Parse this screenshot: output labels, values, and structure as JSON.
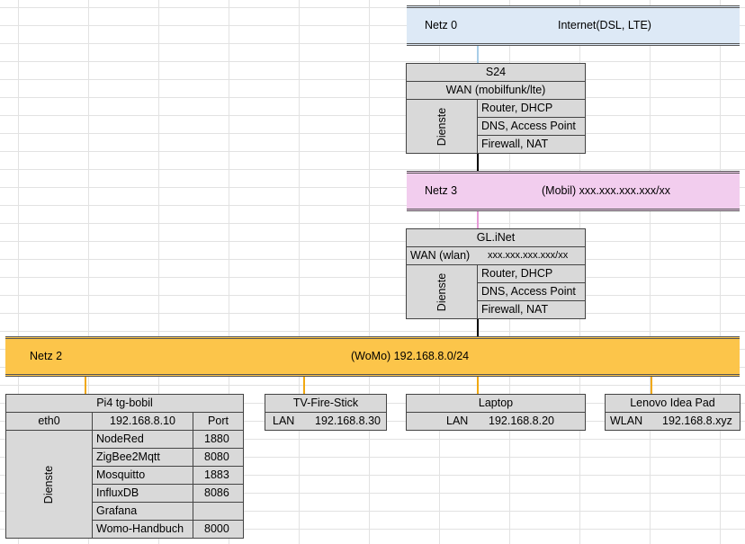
{
  "networks": {
    "netz0": {
      "label": "Netz 0",
      "description": "Internet(DSL, LTE)",
      "color": "#dde9f6"
    },
    "netz3": {
      "label": "Netz 3",
      "description": "(Mobil) xxx.xxx.xxx.xxx/xx",
      "color": "#f2cdee"
    },
    "netz2": {
      "label": "Netz 2",
      "description": "(WoMo) 192.168.8.0/24",
      "color": "#fcc54a"
    }
  },
  "s24": {
    "title": "S24",
    "wan": "WAN (mobilfunk/lte)",
    "dienste_label": "Dienste",
    "services": [
      "Router, DHCP",
      "DNS, Access Point",
      "Firewall, NAT"
    ]
  },
  "glinet": {
    "title": "GL.iNet",
    "wan_label": "WAN (wlan)",
    "wan_value": "xxx.xxx.xxx.xxx/xx",
    "dienste_label": "Dienste",
    "services": [
      "Router, DHCP",
      "DNS, Access Point",
      "Firewall, NAT"
    ]
  },
  "pi4": {
    "title": "Pi4 tg-bobil",
    "iface": "eth0",
    "ip": "192.168.8.10",
    "port_header": "Port",
    "dienste_label": "Dienste",
    "services": [
      {
        "name": "NodeRed",
        "port": "1880"
      },
      {
        "name": "ZigBee2Mqtt",
        "port": "8080"
      },
      {
        "name": "Mosquitto",
        "port": "1883"
      },
      {
        "name": "InfluxDB",
        "port": "8086"
      },
      {
        "name": "Grafana",
        "port": ""
      },
      {
        "name": "Womo-Handbuch",
        "port": "8000"
      }
    ]
  },
  "firestick": {
    "title": "TV-Fire-Stick",
    "iface": "LAN",
    "ip": "192.168.8.30"
  },
  "laptop": {
    "title": "Laptop",
    "iface": "LAN",
    "ip": "192.168.8.20"
  },
  "lenovo": {
    "title": "Lenovo Idea Pad",
    "iface": "WLAN",
    "ip": "192.168.8.xyz"
  }
}
